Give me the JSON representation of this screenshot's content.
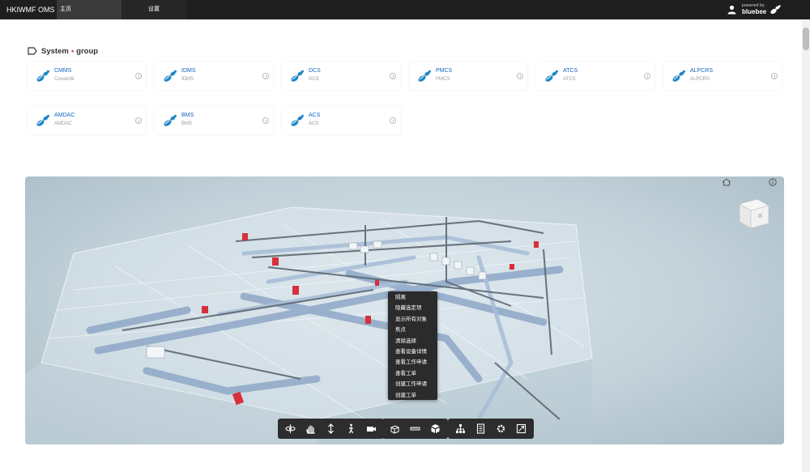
{
  "app": {
    "title": "HKIWMF OMS"
  },
  "nav": {
    "home": "主页",
    "settings": "设置"
  },
  "brand": {
    "powered": "powered by",
    "name": "bluebee"
  },
  "group": {
    "name_left": "System",
    "separator": "•",
    "name_right": "group"
  },
  "cards": [
    {
      "title": "CMMS",
      "sub": "Coswin8i"
    },
    {
      "title": "IDMS",
      "sub": "IDMS"
    },
    {
      "title": "DCS",
      "sub": "DCS"
    },
    {
      "title": "PMCS",
      "sub": "PMCS"
    },
    {
      "title": "ATCS",
      "sub": "ATCS"
    },
    {
      "title": "ALPCRS",
      "sub": "ALPCRS"
    },
    {
      "title": "AMDAC",
      "sub": "AMDAC"
    },
    {
      "title": "BMS",
      "sub": "BMS"
    },
    {
      "title": "ACS",
      "sub": "ACS"
    }
  ],
  "context_menu": [
    "隔离",
    "隐藏选定项",
    "显示所有对象",
    "焦点",
    "清除选择",
    "查看设备详情",
    "查看工作申请",
    "查看工单",
    "创建工作申请",
    "创建工单"
  ],
  "toolbar": {
    "groups": [
      [
        "orbit-icon",
        "pan-icon",
        "dolly-icon",
        "walk-icon",
        "camera-icon"
      ],
      [
        "section-icon",
        "measure-icon",
        "explode-icon"
      ],
      [
        "model-browser-icon",
        "properties-icon",
        "settings-icon",
        "fullscreen-icon"
      ]
    ]
  },
  "colors": {
    "accent": "#1565c0",
    "topbar": "#1e1e1e",
    "danger": "#e53935"
  }
}
